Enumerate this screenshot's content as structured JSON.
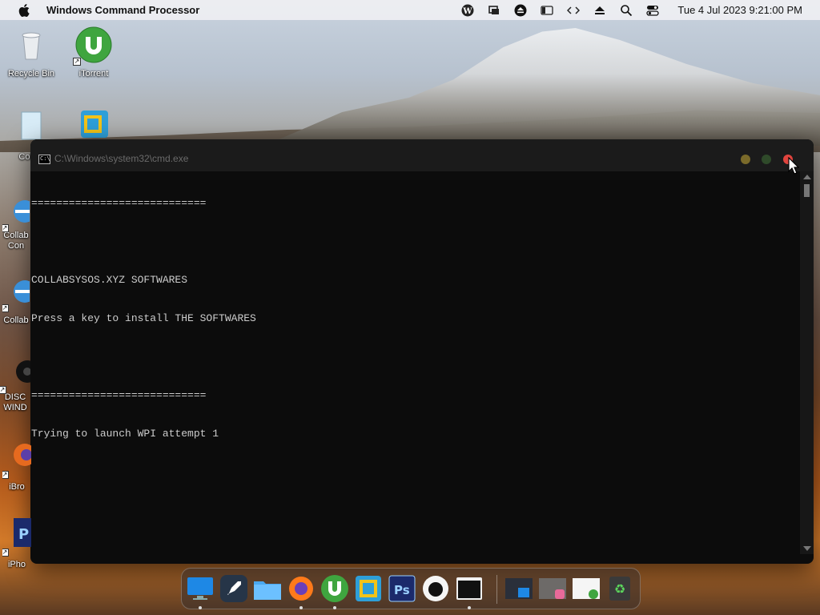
{
  "menubar": {
    "app_name": "Windows Command Processor",
    "clock": "Tue 4 Jul 2023  9:21:00 PM",
    "status_icons": [
      "wordpress-icon",
      "display-icon",
      "eject-circle-icon",
      "sidebar-icon",
      "code-icon",
      "eject-icon",
      "search-icon",
      "control-center-icon"
    ]
  },
  "desktop": {
    "icons": [
      {
        "label": "Recycle Bin",
        "icon": "recycle-bin-icon"
      },
      {
        "label": "iTorrent",
        "icon": "utorrent-icon"
      },
      {
        "label": "Collab",
        "icon": "document-icon"
      },
      {
        "label": "Collab\nCon",
        "icon": "internet-explorer-icon"
      },
      {
        "label": "Collab",
        "icon": "internet-explorer-icon"
      },
      {
        "label": "DISC\nWIND",
        "icon": "disc-icon"
      },
      {
        "label": "iBro",
        "icon": "firefox-icon"
      },
      {
        "label": "iPho",
        "icon": "photoshop-icon"
      }
    ]
  },
  "cmd": {
    "title": "C:\\Windows\\system32\\cmd.exe",
    "lines": [
      "============================",
      "",
      "COLLABSYSOS.XYZ SOFTWARES",
      "Press a key to install THE SOFTWARES",
      "",
      "============================",
      "Trying to launch WPI attempt 1"
    ]
  },
  "dock": {
    "items": [
      "finder-icon",
      "launchpad-icon",
      "folder-icon",
      "firefox-icon",
      "utorrent-icon",
      "vmware-icon",
      "photoshop-icon",
      "apple-icon",
      "terminal-icon",
      "window-thumbnail-1",
      "window-thumbnail-2",
      "window-thumbnail-3",
      "trash-icon"
    ]
  },
  "colors": {
    "console_bg": "#0c0c0c",
    "console_text": "#cccccc",
    "close_button": "#e0443e"
  }
}
